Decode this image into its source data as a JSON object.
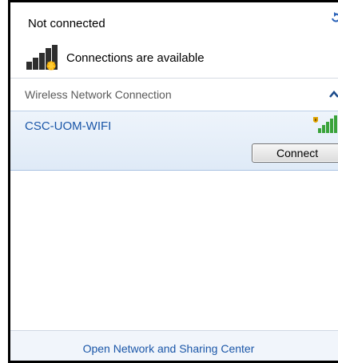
{
  "status": {
    "title": "Not connected",
    "availability_text": "Connections are available"
  },
  "group": {
    "label": "Wireless Network Connection"
  },
  "networks": [
    {
      "name": "CSC-UOM-WIFI",
      "connect_label": "Connect"
    }
  ],
  "footer": {
    "link_label": "Open Network and Sharing Center"
  },
  "icons": {
    "refresh": "refresh-icon",
    "network_bars": "network-bars-warning-icon",
    "collapse": "chevron-up-icon",
    "wifi_signal": "secured-wifi-signal-icon"
  },
  "colors": {
    "link_blue": "#1a56a8",
    "selected_item_bg": "#dfeaf7",
    "footer_bg": "#f1f5fb"
  }
}
